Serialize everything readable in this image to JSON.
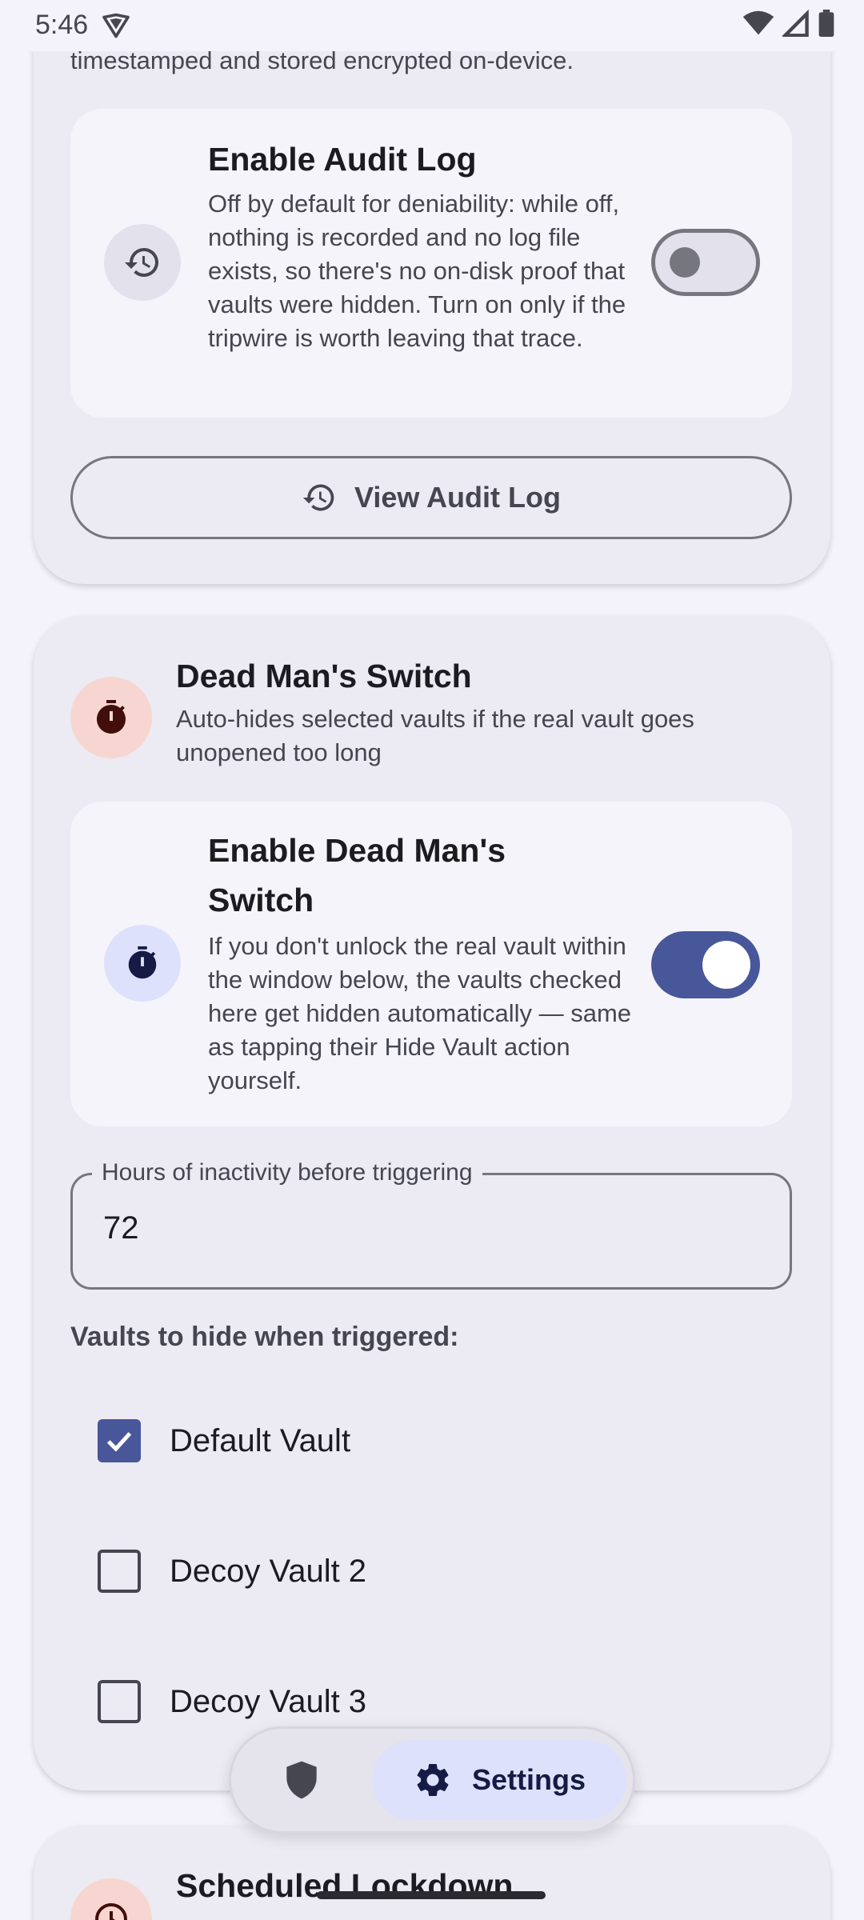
{
  "status_bar": {
    "time": "5:46"
  },
  "audit_card": {
    "trailing_text": "timestamped and stored encrypted on-device.",
    "enable_title": "Enable Audit Log",
    "enable_description": "Off by default for deniability: while off, nothing is recorded and no log file exists, so there's no on-disk proof that vaults were hidden. Turn on only if the tripwire is worth leaving that trace.",
    "enabled": false,
    "view_button": "View Audit Log"
  },
  "dms_card": {
    "title": "Dead Man's Switch",
    "subtitle": "Auto-hides selected vaults if the real vault goes unopened too long",
    "enable_title": "Enable Dead Man's Switch",
    "enable_description": "If you don't unlock the real vault within the window below, the vaults checked here get hidden automatically — same as tapping their Hide Vault action yourself.",
    "enabled": true,
    "hours_label": "Hours of inactivity before triggering",
    "hours_value": "72",
    "vaults_heading": "Vaults to hide when triggered:",
    "vaults": [
      {
        "name": "Default Vault",
        "checked": true
      },
      {
        "name": "Decoy Vault 2",
        "checked": false
      },
      {
        "name": "Decoy Vault 3",
        "checked": false
      }
    ]
  },
  "scheduled_card": {
    "title": "Scheduled Lockdown"
  },
  "nav": {
    "settings_label": "Settings"
  },
  "colors": {
    "accent": "#48579a",
    "accent_container": "#dee1fb",
    "danger_container": "#f7d6d1",
    "card_bg": "#eceaf2"
  }
}
